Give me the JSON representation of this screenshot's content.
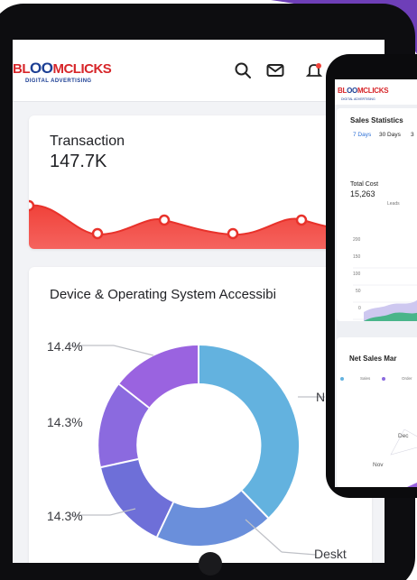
{
  "tablet": {
    "logo": {
      "text_pre": "BL",
      "text_oo": "OO",
      "text_post": "MCLICKS",
      "subtitle": "DIGITAL ADVERTISING"
    },
    "header_icons": [
      "search-icon",
      "mail-icon",
      "bell-icon"
    ],
    "transaction_card": {
      "title": "Transaction",
      "value": "147.7K"
    },
    "device_card": {
      "title": "Device & Operating System Accessibi",
      "labels": [
        "14.4%",
        "14.3%",
        "14.3%"
      ],
      "right_labels": [
        "N",
        "Deskt"
      ]
    }
  },
  "phone": {
    "logo": {
      "text_pre": "BL",
      "text_oo": "OO",
      "text_post": "MCLICKS",
      "subtitle": "DIGITAL ADVERTISING"
    },
    "sales_card": {
      "title": "Sales Statistics",
      "tabs": [
        "7 Days",
        "30 Days",
        "3"
      ],
      "total_cost_label": "Total Cost",
      "total_cost_value": "15,263",
      "sub_label": "Leads",
      "y_ticks": [
        "200",
        "150",
        "100",
        "50",
        "0"
      ]
    },
    "net_sales_card": {
      "title": "Net Sales Mar",
      "legend": [
        "Sales",
        "Order"
      ],
      "labels": [
        "Dec",
        "Nov"
      ]
    }
  },
  "colors": {
    "accent_red": "#f0423a",
    "donut_blue": "#63b2df",
    "donut_mid": "#6a8fdb",
    "donut_indigo": "#6e6fd8",
    "donut_purple": "#8b6adf",
    "donut_violet": "#9a63e0",
    "logo_red": "#d7262a",
    "logo_blue": "#1c3f94"
  }
}
